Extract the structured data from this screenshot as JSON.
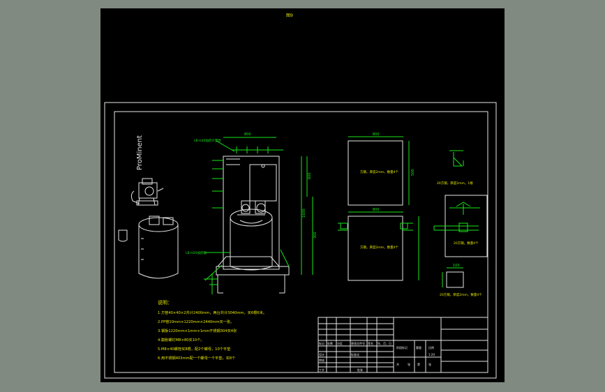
{
  "header_mark": "图9",
  "brand": "ProMinent",
  "panel_top_note": "方钢，厚度2mm，数量4个",
  "panel_bottom_note": "方钢，厚度2mm，数量4个",
  "right_note_1": "20方钢，厚度2mm，1根",
  "right_note_2": "20方钢，数量4个",
  "right_note_3": "20方钢，厚度2mm，数量4个",
  "label_pump": "LB-H20加药计量泵",
  "label_tank": "LB-H20加药箱",
  "notes_title": "说明：",
  "notes": [
    "1.方管40×40×2共计2400mm，两台共计3040mm，买6根6米。",
    "2.PP管10mm×1220mm×2440mm买一张。",
    "3.钢板1220mm×1mm×1mm不锈钢304买4张",
    "4.膨胀螺钉M8×80买10个。",
    "5.M8×40螺栓买8根，配2个螺母，10个平垫",
    "6.用不锈钢403mm配一个螺母一个平垫，买8个"
  ],
  "title_block": {
    "row1": [
      "标记",
      "处数",
      "分区",
      "更改文件号",
      "签名",
      "年、月、日"
    ],
    "row2": [
      "设计",
      "",
      "",
      "标准化",
      "",
      ""
    ],
    "row3": [
      "审核",
      ""
    ],
    "row4": [
      "工艺",
      "",
      "批准"
    ],
    "stage": [
      "阶段标记",
      "重量",
      "比例"
    ],
    "stage_val": "1:20",
    "sheet": [
      "共",
      "张",
      "第",
      "张"
    ]
  },
  "dims": {
    "top_width": "800",
    "height_main": "1600",
    "side_h1": "600",
    "side_h2": "300",
    "panel_w": "800",
    "panel_h": "500",
    "small_w": "100"
  }
}
